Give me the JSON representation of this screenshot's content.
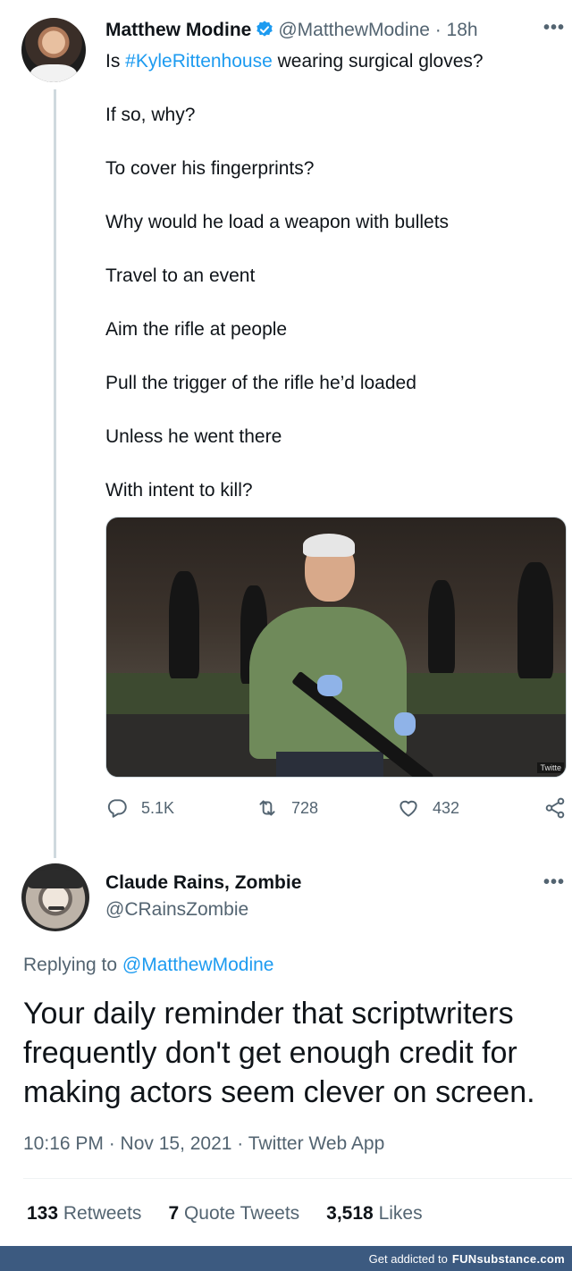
{
  "tweet": {
    "author_name": "Matthew Modine",
    "author_handle": "@MatthewModine",
    "time_ago": "· 18h",
    "body": {
      "line1_prefix": "Is ",
      "hashtag": "#KyleRittenhouse",
      "line1_suffix": " wearing surgical gloves?",
      "lines": [
        "If so, why?",
        "To cover his fingerprints?",
        "Why would he load a weapon with bullets",
        "Travel to an event",
        "Aim the rifle at people",
        "Pull the trigger of the rifle he’d loaded",
        "Unless he went there",
        "With intent to kill?"
      ]
    },
    "media_watermark": "Twitte",
    "actions": {
      "replies": "5.1K",
      "retweets": "728",
      "likes": "432"
    }
  },
  "reply": {
    "author_name": "Claude Rains, Zombie",
    "author_handle": "@CRainsZombie",
    "replying_label": "Replying to",
    "replying_to": "@MatthewModine",
    "text": "Your daily reminder that scriptwriters frequently don't get enough credit for making actors seem clever on screen.",
    "timestamp": "10:16 PM · Nov 15, 2021 · Twitter Web App",
    "stats": {
      "retweets_count": "133",
      "retweets_label": "Retweets",
      "quotes_count": "7",
      "quotes_label": "Quote Tweets",
      "likes_count": "3,518",
      "likes_label": "Likes"
    }
  },
  "footer": {
    "tagline": "Get addicted to",
    "brand": "FUNsubstance.com"
  },
  "colors": {
    "link": "#1d9bf0",
    "secondary_text": "#536471",
    "footer_bg": "#3c5a80"
  },
  "icons": [
    "verified-badge-icon",
    "more-options-icon",
    "reply-icon",
    "retweet-icon",
    "like-icon",
    "share-icon"
  ]
}
